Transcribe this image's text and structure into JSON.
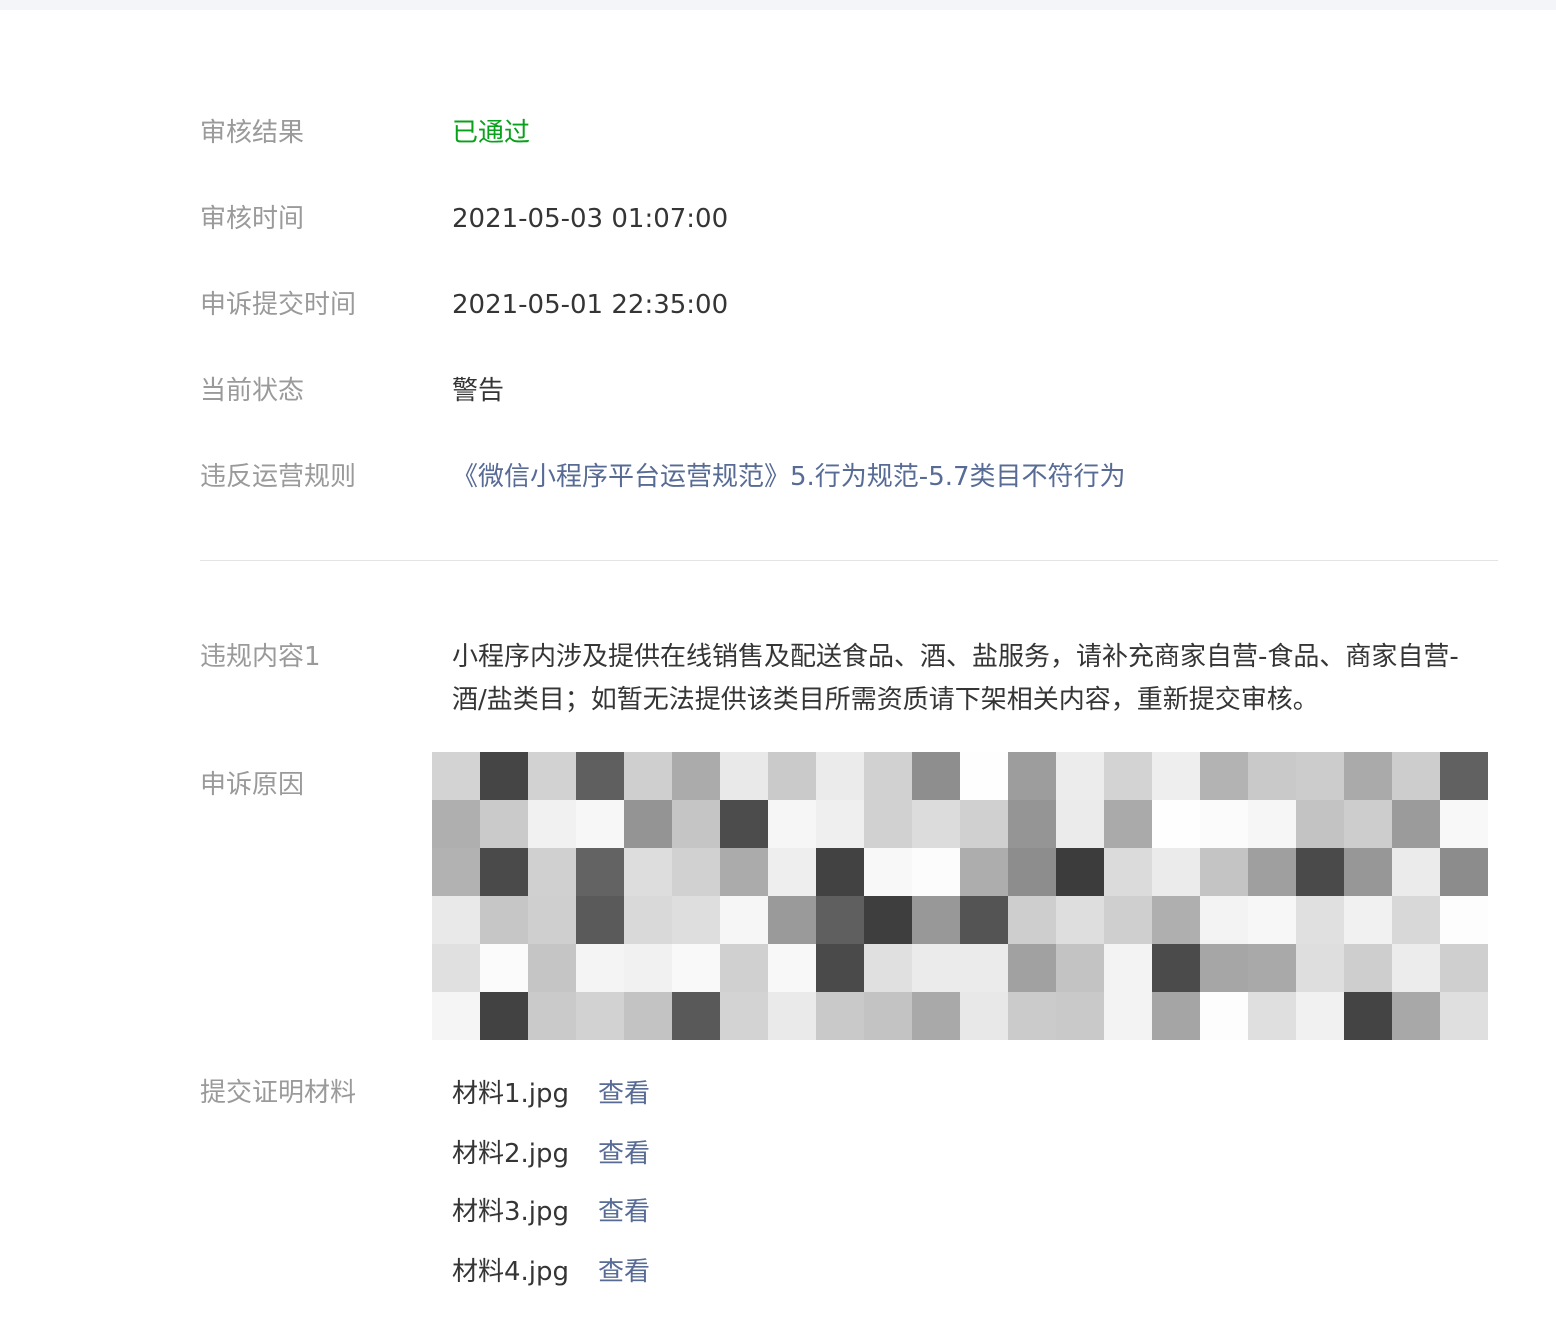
{
  "review": {
    "result_label": "审核结果",
    "result_value": "已通过",
    "time_label": "审核时间",
    "time_value": "2021-05-03 01:07:00",
    "submit_label": "申诉提交时间",
    "submit_value": "2021-05-01 22:35:00",
    "status_label": "当前状态",
    "status_value": "警告",
    "rule_label": "违反运营规则",
    "rule_value": "《微信小程序平台运营规范》5.行为规范-5.7类目不符行为"
  },
  "violation": {
    "label": "违规内容1",
    "text": "小程序内涉及提供在线销售及配送食品、酒、盐服务，请补充商家自营-食品、商家自营-酒/盐类目；如暂无法提供该类目所需资质请下架相关内容，重新提交审核。"
  },
  "appeal": {
    "label": "申诉原因"
  },
  "materials": {
    "label": "提交证明材料",
    "view_label": "查看",
    "files": [
      "材料1.jpg",
      "材料2.jpg",
      "材料3.jpg",
      "材料4.jpg"
    ]
  },
  "colors": {
    "label": "#9a9a9a",
    "text": "#353535",
    "success": "#09a01b",
    "link": "#576b95",
    "divider": "#e3e3e3"
  }
}
